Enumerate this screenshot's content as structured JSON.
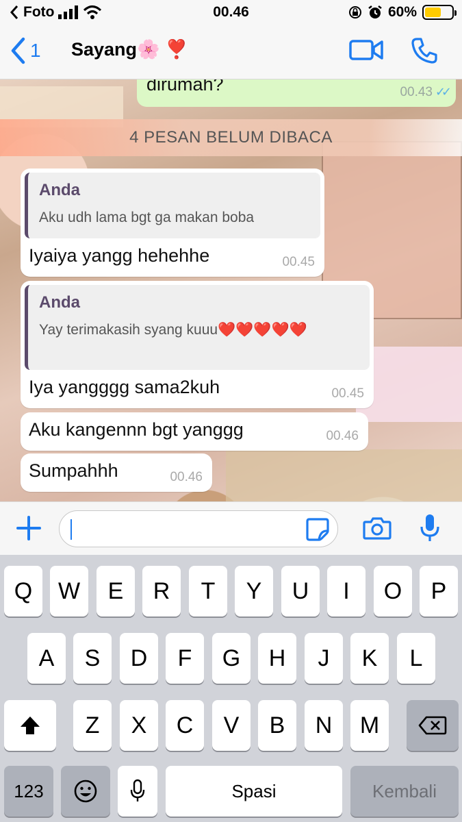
{
  "status_bar": {
    "back_app": "Foto",
    "time": "00.46",
    "battery": "60%",
    "battery_level": 0.6,
    "icons": [
      "signal-icon",
      "wifi-icon",
      "lock-rotation-icon",
      "alarm-icon",
      "battery-icon"
    ]
  },
  "header": {
    "back_count": "1",
    "contact_name": "Sayang🌸 ❣️",
    "icons": [
      "chevron-left-icon",
      "video-call-icon",
      "phone-icon"
    ]
  },
  "chat": {
    "outgoing": {
      "text": "dirumah?",
      "time": "00.43"
    },
    "unread_banner": "4 PESAN BELUM DIBACA",
    "messages": [
      {
        "quote_name": "Anda",
        "quote_text": "Aku udh lama bgt ga makan boba",
        "text": "Iyaiya yangg hehehhe",
        "time": "00.45"
      },
      {
        "quote_name": "Anda",
        "quote_text": "Yay terimakasih syang kuuu❤️❤️❤️❤️❤️",
        "text": "Iya yangggg sama2kuh",
        "time": "00.45"
      },
      {
        "text": "Aku kangennn bgt yanggg",
        "time": "00.46"
      },
      {
        "text": "Sumpahhh",
        "time": "00.46"
      }
    ]
  },
  "input": {
    "placeholder": "",
    "icons": [
      "plus-icon",
      "sticker-icon",
      "camera-icon",
      "mic-icon"
    ]
  },
  "keyboard": {
    "row1": [
      "Q",
      "W",
      "E",
      "R",
      "T",
      "Y",
      "U",
      "I",
      "O",
      "P"
    ],
    "row2": [
      "A",
      "S",
      "D",
      "F",
      "G",
      "H",
      "J",
      "K",
      "L"
    ],
    "row3": [
      "Z",
      "X",
      "C",
      "V",
      "B",
      "N",
      "M"
    ],
    "numbers_key": "123",
    "space_key": "Spasi",
    "return_key": "Kembali",
    "icons": [
      "shift-icon",
      "backspace-icon",
      "emoji-icon",
      "dictation-mic-icon"
    ]
  },
  "colors": {
    "accent": "#1e7cf0",
    "outgoing_bubble": "#dcf8c6",
    "quote_bar": "#5b4a6b"
  }
}
